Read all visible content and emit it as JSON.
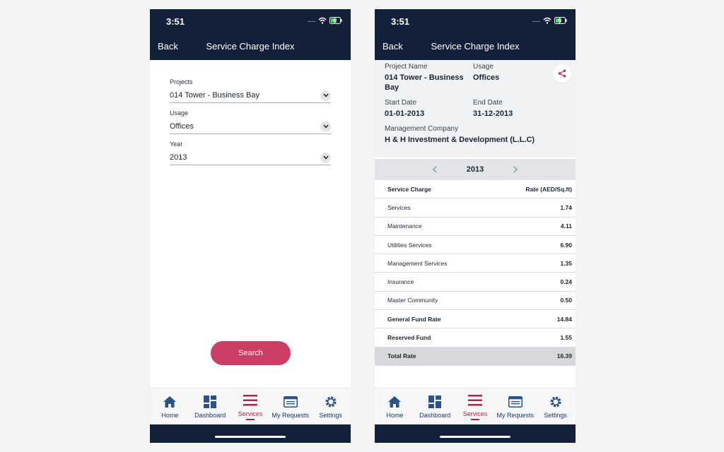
{
  "status": {
    "time": "3:51",
    "signal": "...."
  },
  "header": {
    "back_label": "Back",
    "title": "Service Charge Index"
  },
  "search_form": {
    "fields": [
      {
        "label": "Projects",
        "value": "014 Tower - Business Bay"
      },
      {
        "label": "Usage",
        "value": "Offices"
      },
      {
        "label": "Year",
        "value": "2013"
      }
    ],
    "search_label": "Search"
  },
  "details": {
    "project_name_label": "Project Name",
    "project_name": "014 Tower - Business Bay",
    "usage_label": "Usage",
    "usage": "Offices",
    "start_date_label": "Start Date",
    "start_date": "01-01-2013",
    "end_date_label": "End Date",
    "end_date": "31-12-2013",
    "management_company_label": "Management Company",
    "management_company": "H & H Investment & Development (L.L.C)"
  },
  "year_selector": {
    "year": "2013"
  },
  "rates": {
    "col_service": "Service Charge",
    "col_rate": "Rate (AED/Sq.ft)",
    "rows": [
      {
        "name": "Services",
        "value": "1.74",
        "bold": false
      },
      {
        "name": "Maintenance",
        "value": "4.11",
        "bold": false
      },
      {
        "name": "Utilities Services",
        "value": "6.90",
        "bold": false
      },
      {
        "name": "Management Services",
        "value": "1.35",
        "bold": false
      },
      {
        "name": "Insurance",
        "value": "0.24",
        "bold": false
      },
      {
        "name": "Master Community",
        "value": "0.50",
        "bold": false
      },
      {
        "name": "General Fund Rate",
        "value": "14.84",
        "bold": true
      },
      {
        "name": "Reserved Fund",
        "value": "1.55",
        "bold": true
      }
    ],
    "total": {
      "name": "Total Rate",
      "value": "16.39"
    }
  },
  "nav": {
    "items": [
      {
        "label": "Home",
        "icon": "home-icon"
      },
      {
        "label": "Dashboard",
        "icon": "dashboard-icon"
      },
      {
        "label": "Services",
        "icon": "menu-lines-icon",
        "active": true
      },
      {
        "label": "My Requests",
        "icon": "requests-icon"
      },
      {
        "label": "Settings",
        "icon": "gear-icon"
      }
    ]
  },
  "colors": {
    "header_bg": "#13203a",
    "accent": "#cc3d63",
    "active_nav": "#a8264a",
    "nav_icon": "#2d5286"
  }
}
